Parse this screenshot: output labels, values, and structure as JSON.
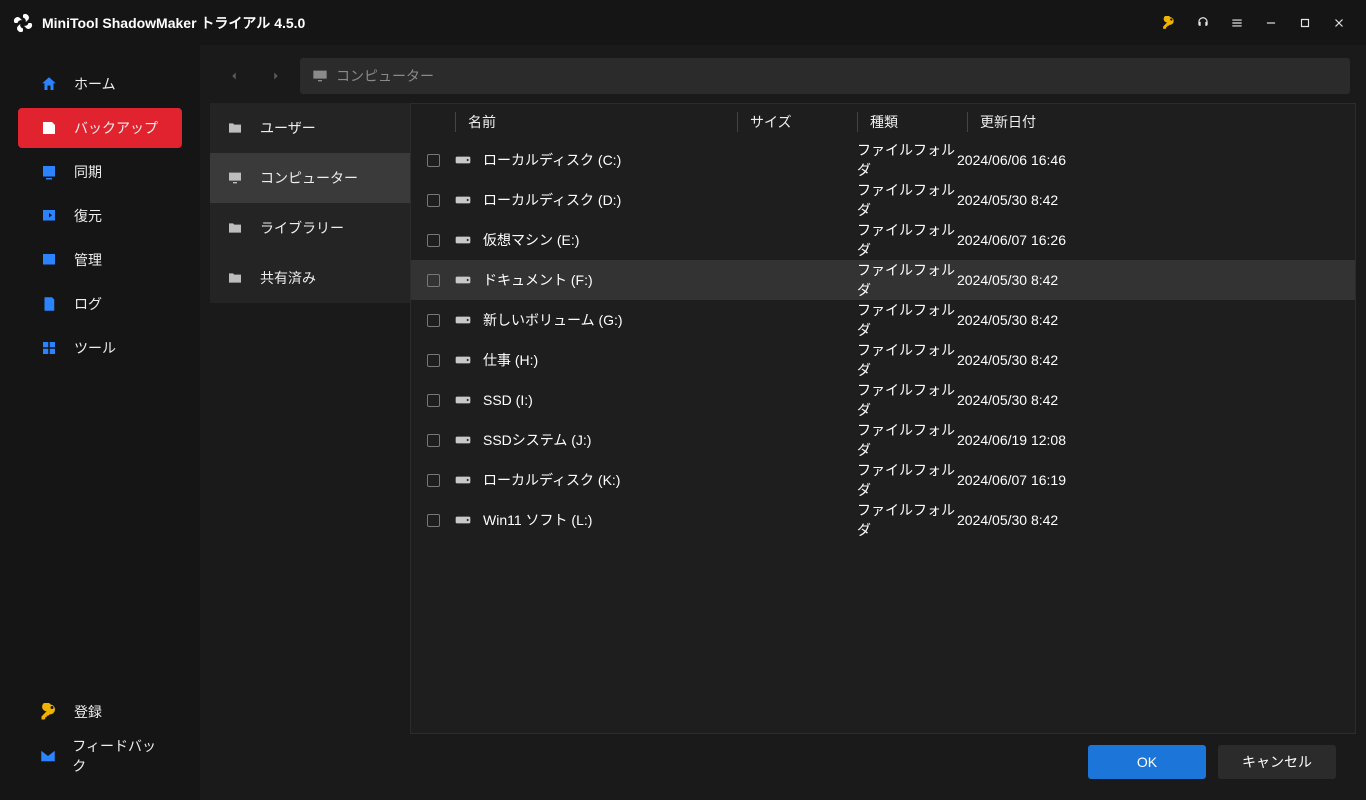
{
  "titlebar": {
    "app_name": "MiniTool ShadowMaker",
    "edition": "トライアル",
    "version": "4.5.0"
  },
  "sidebar": {
    "items": [
      {
        "id": "home",
        "label": "ホーム",
        "icon": "home"
      },
      {
        "id": "backup",
        "label": "バックアップ",
        "icon": "backup",
        "active": true
      },
      {
        "id": "sync",
        "label": "同期",
        "icon": "sync"
      },
      {
        "id": "restore",
        "label": "復元",
        "icon": "restore"
      },
      {
        "id": "manage",
        "label": "管理",
        "icon": "manage"
      },
      {
        "id": "logs",
        "label": "ログ",
        "icon": "log"
      },
      {
        "id": "tools",
        "label": "ツール",
        "icon": "tools"
      }
    ],
    "bottom": [
      {
        "id": "register",
        "label": "登録",
        "icon": "key"
      },
      {
        "id": "feedback",
        "label": "フィードバック",
        "icon": "mail"
      }
    ]
  },
  "address": {
    "label": "コンピューター"
  },
  "tree": {
    "items": [
      {
        "id": "users",
        "label": "ユーザー",
        "icon": "folder-user"
      },
      {
        "id": "computer",
        "label": "コンピューター",
        "icon": "monitor",
        "selected": true
      },
      {
        "id": "library",
        "label": "ライブラリー",
        "icon": "folder"
      },
      {
        "id": "shared",
        "label": "共有済み",
        "icon": "folder"
      }
    ]
  },
  "columns": {
    "name": "名前",
    "size": "サイズ",
    "type": "種類",
    "date": "更新日付"
  },
  "rows": [
    {
      "name": "ローカルディスク (C:)",
      "size": "",
      "type": "ファイルフォルダ",
      "date": "2024/06/06 16:46"
    },
    {
      "name": "ローカルディスク (D:)",
      "size": "",
      "type": "ファイルフォルダ",
      "date": "2024/05/30 8:42"
    },
    {
      "name": "仮想マシン (E:)",
      "size": "",
      "type": "ファイルフォルダ",
      "date": "2024/06/07 16:26"
    },
    {
      "name": "ドキュメント (F:)",
      "size": "",
      "type": "ファイルフォルダ",
      "date": "2024/05/30 8:42",
      "hover": true
    },
    {
      "name": "新しいボリューム (G:)",
      "size": "",
      "type": "ファイルフォルダ",
      "date": "2024/05/30 8:42"
    },
    {
      "name": "仕事 (H:)",
      "size": "",
      "type": "ファイルフォルダ",
      "date": "2024/05/30 8:42"
    },
    {
      "name": "SSD (I:)",
      "size": "",
      "type": "ファイルフォルダ",
      "date": "2024/05/30 8:42"
    },
    {
      "name": "SSDシステム (J:)",
      "size": "",
      "type": "ファイルフォルダ",
      "date": "2024/06/19 12:08"
    },
    {
      "name": "ローカルディスク (K:)",
      "size": "",
      "type": "ファイルフォルダ",
      "date": "2024/06/07 16:19"
    },
    {
      "name": "Win11 ソフト (L:)",
      "size": "",
      "type": "ファイルフォルダ",
      "date": "2024/05/30 8:42"
    }
  ],
  "footer": {
    "ok": "OK",
    "cancel": "キャンセル"
  }
}
